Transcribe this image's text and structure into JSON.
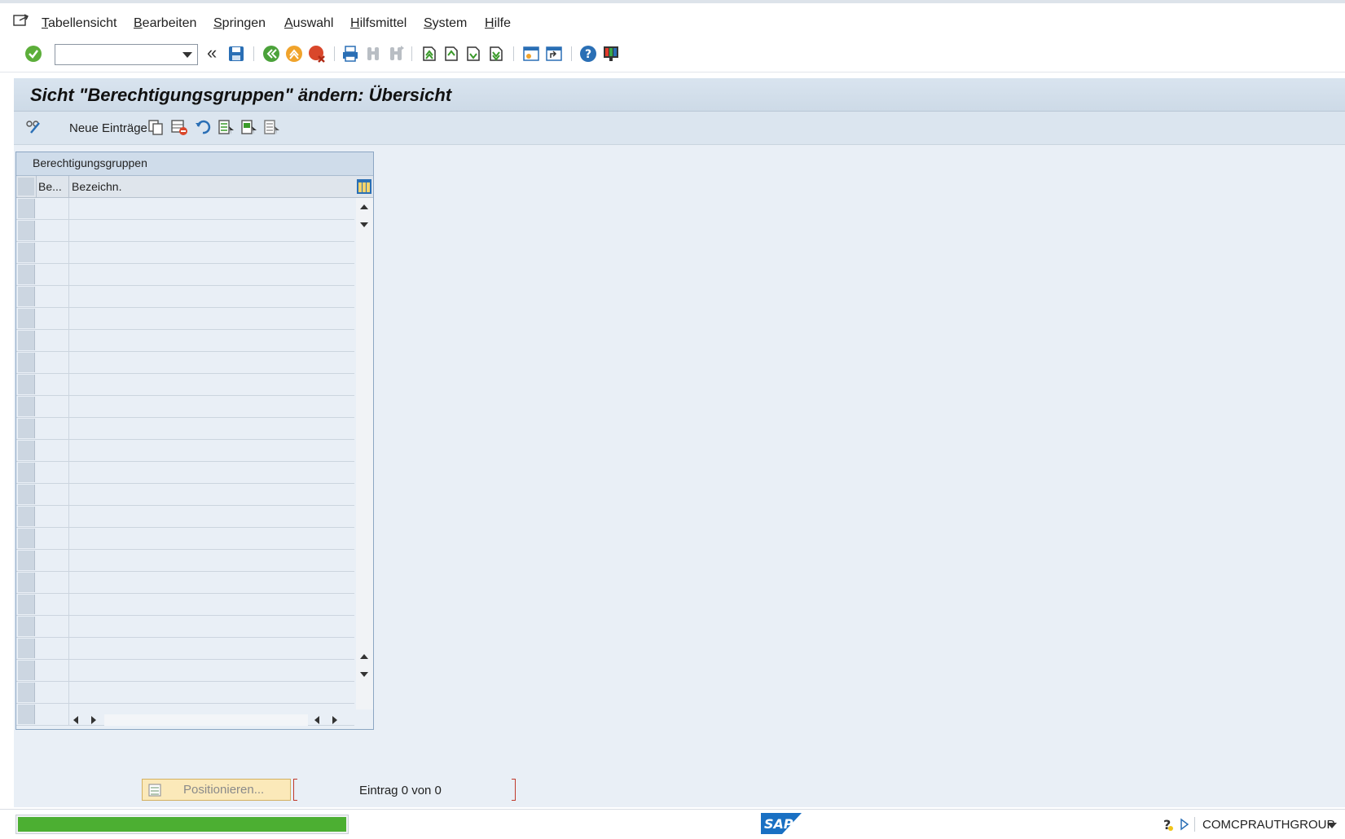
{
  "menu": {
    "items": [
      "Tabellensicht",
      "Bearbeiten",
      "Springen",
      "Auswahl",
      "Hilfsmittel",
      "System",
      "Hilfe"
    ]
  },
  "toolbar": {
    "command_value": "",
    "icons": [
      "enter-icon",
      "command-dropdown",
      "double-chevron-icon",
      "save-icon",
      "back-icon",
      "exit-icon",
      "cancel-icon",
      "print-icon",
      "find-icon",
      "find-next-icon",
      "first-page-icon",
      "previous-page-icon",
      "next-page-icon",
      "last-page-icon",
      "new-session-icon",
      "shortcut-icon",
      "help-icon",
      "customize-layout-icon"
    ]
  },
  "title": "Sicht \"Berechtigungsgruppen\" ändern: Übersicht",
  "app_toolbar": {
    "new_entries_label": "Neue Einträge"
  },
  "table": {
    "title": "Berechtigungsgruppen",
    "columns": [
      "Be...",
      "Bezeichn."
    ],
    "row_count": 24,
    "rows": []
  },
  "position_button": "Positionieren...",
  "entry_status": "Eintrag 0 von 0",
  "status": {
    "progress_fraction": 1.0,
    "logo_text": "SAP",
    "system_name": "COMCPRAUTHGROUP"
  },
  "colors": {
    "main_background": "#e9eff6",
    "progress_green": "#4caf32",
    "position_button_bg": "#fbe9b9",
    "sap_blue": "#1a70c3"
  }
}
